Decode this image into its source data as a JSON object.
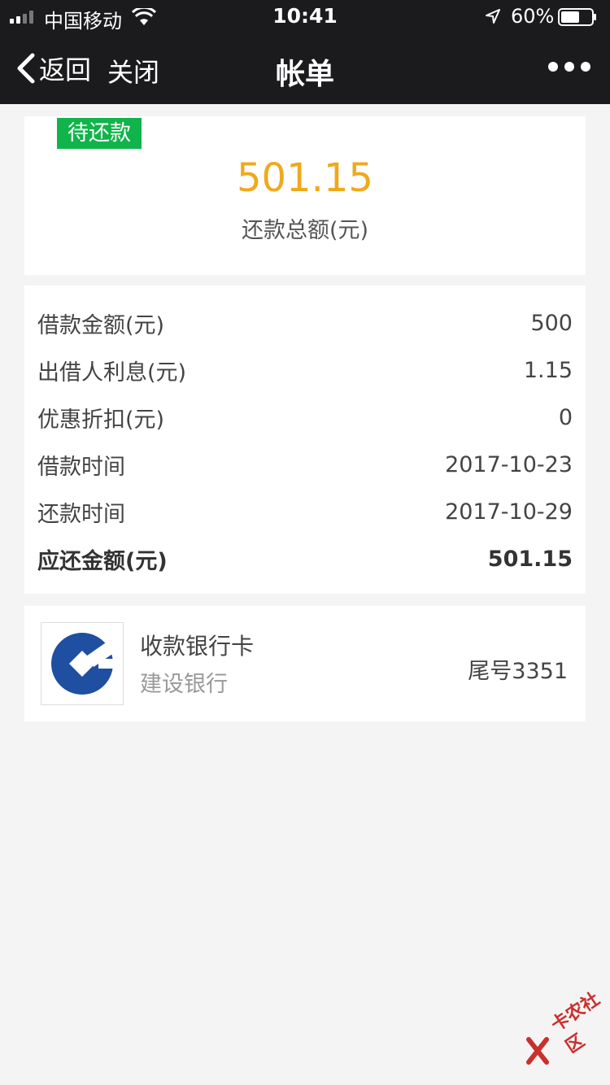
{
  "status_bar": {
    "carrier": "中国移动",
    "time": "10:41",
    "battery": "60%",
    "battery_level": 0.6
  },
  "nav": {
    "back_label": "返回",
    "close_label": "关闭",
    "title": "帐单"
  },
  "summary": {
    "tag": "待还款",
    "amount": "501.15",
    "label": "还款总额(元)",
    "amount_color": "#f0a91c",
    "tag_color": "#11b44a"
  },
  "details": [
    {
      "label": "借款金额(元)",
      "value": "500"
    },
    {
      "label": "出借人利息(元)",
      "value": "1.15"
    },
    {
      "label": "优惠折扣(元)",
      "value": "0"
    },
    {
      "label": "借款时间",
      "value": "2017-10-23"
    },
    {
      "label": "还款时间",
      "value": "2017-10-29"
    },
    {
      "label": "应还金额(元)",
      "value": "501.15"
    }
  ],
  "bank": {
    "title": "收款银行卡",
    "name": "建设银行",
    "tail": "尾号3351",
    "logo_color": "#1f4fa0"
  },
  "watermark": "卡农社区"
}
